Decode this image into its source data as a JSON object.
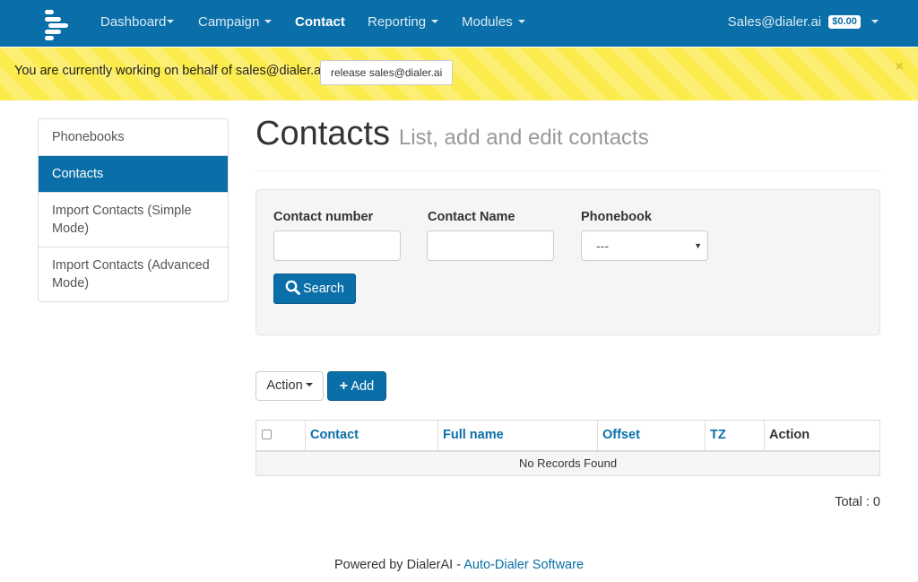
{
  "navbar": {
    "items": [
      {
        "label": "Dashboard"
      },
      {
        "label": "Campaign"
      },
      {
        "label": "Contact"
      },
      {
        "label": "Reporting"
      },
      {
        "label": "Modules"
      }
    ],
    "user": "Sales@dialer.ai",
    "balance": "$0.00",
    "active_item": "Contact",
    "colors": {
      "bar": "#0a6fa8"
    }
  },
  "alert": {
    "message": "You are currently working on behalf of sales@dialer.ai.",
    "release_label": "release sales@dialer.ai",
    "close_symbol": "×",
    "colors": {
      "background": "#fceb4c"
    }
  },
  "sidebar": {
    "items": [
      {
        "label": "Phonebooks"
      },
      {
        "label": "Contacts"
      },
      {
        "label": "Import Contacts (Simple Mode)"
      },
      {
        "label": "Import Contacts (Advanced Mode)"
      }
    ],
    "active_item": "Contacts"
  },
  "page": {
    "title": "Contacts",
    "subtitle": "List, add and edit contacts"
  },
  "filters": {
    "contact_number_label": "Contact number",
    "contact_number_value": "",
    "contact_name_label": "Contact Name",
    "contact_name_value": "",
    "phonebook_label": "Phonebook",
    "phonebook_selected": "---",
    "search_label": "Search"
  },
  "toolbar": {
    "action_label": "Action",
    "add_label": "Add"
  },
  "table": {
    "columns": [
      "",
      "Contact",
      "Full name",
      "Offset",
      "TZ",
      "Action"
    ],
    "empty_message": "No Records Found"
  },
  "total": "Total : 0",
  "footer": {
    "prefix": "Powered by DialerAI - ",
    "link": "Auto-Dialer Software"
  },
  "icons": {
    "logo": "dialer-logo-icon",
    "search": "search-icon",
    "plus": "plus-icon",
    "caret": "caret-down-icon",
    "close": "close-icon",
    "checkbox": "checkbox-icon"
  }
}
